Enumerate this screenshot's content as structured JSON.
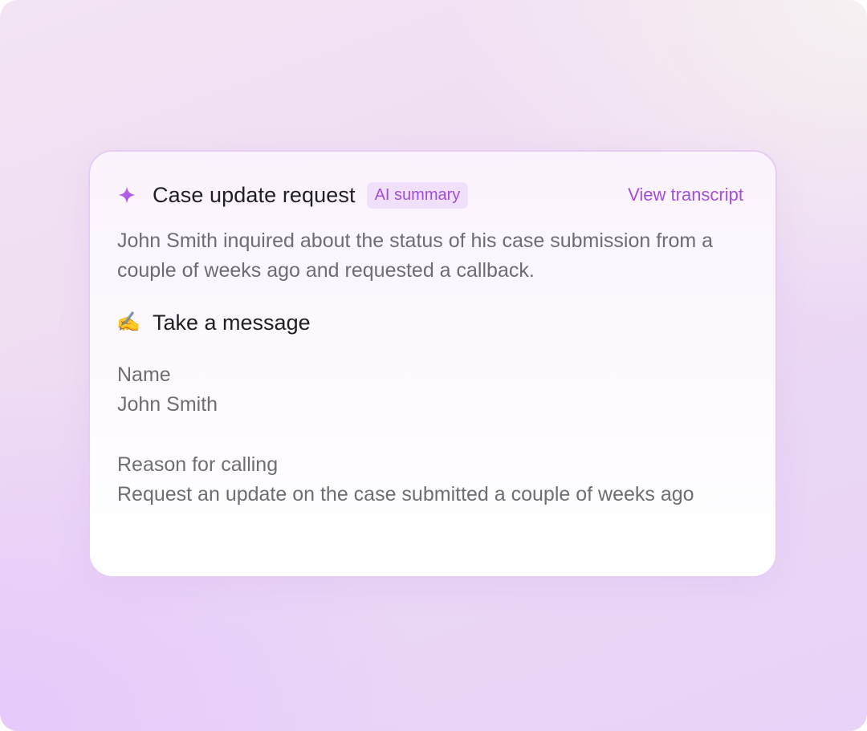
{
  "card": {
    "title": "Case update request",
    "badge": "AI summary",
    "view_link": "View transcript",
    "summary": "John Smith inquired about the status of his case submission from a couple of weeks ago and requested a callback.",
    "section": {
      "icon": "writing-hand-icon",
      "icon_glyph": "✍️",
      "title": "Take a message"
    },
    "fields": [
      {
        "label": "Name",
        "value": "John Smith"
      },
      {
        "label": "Reason for calling",
        "value": "Request an update on the case submitted a couple of weeks ago"
      }
    ]
  },
  "colors": {
    "accent": "#a24fd6",
    "badge_bg": "#f1e0fb",
    "text_primary": "#1f1f24",
    "text_secondary": "#6e6d72",
    "card_border": "#e6cdf4"
  }
}
